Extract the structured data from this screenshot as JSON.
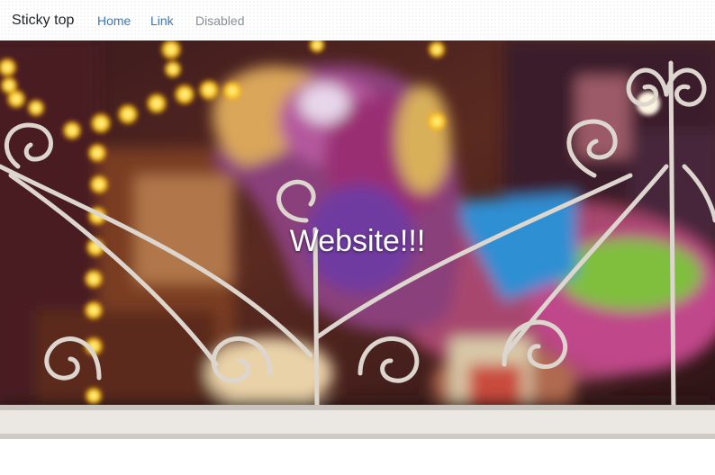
{
  "navbar": {
    "brand": "Sticky top",
    "links": [
      {
        "label": "Home",
        "state": "active"
      },
      {
        "label": "Link",
        "state": "normal"
      },
      {
        "label": "Disabled",
        "state": "disabled"
      }
    ]
  },
  "hero": {
    "headline": "Website!!!",
    "image_subject": "blurred carousel horse behind a white iron railing with lights"
  },
  "colors": {
    "link": "#3f78b8",
    "disabled": "#8a8f96",
    "brand_text": "#212529",
    "headline": "#ffffff"
  }
}
